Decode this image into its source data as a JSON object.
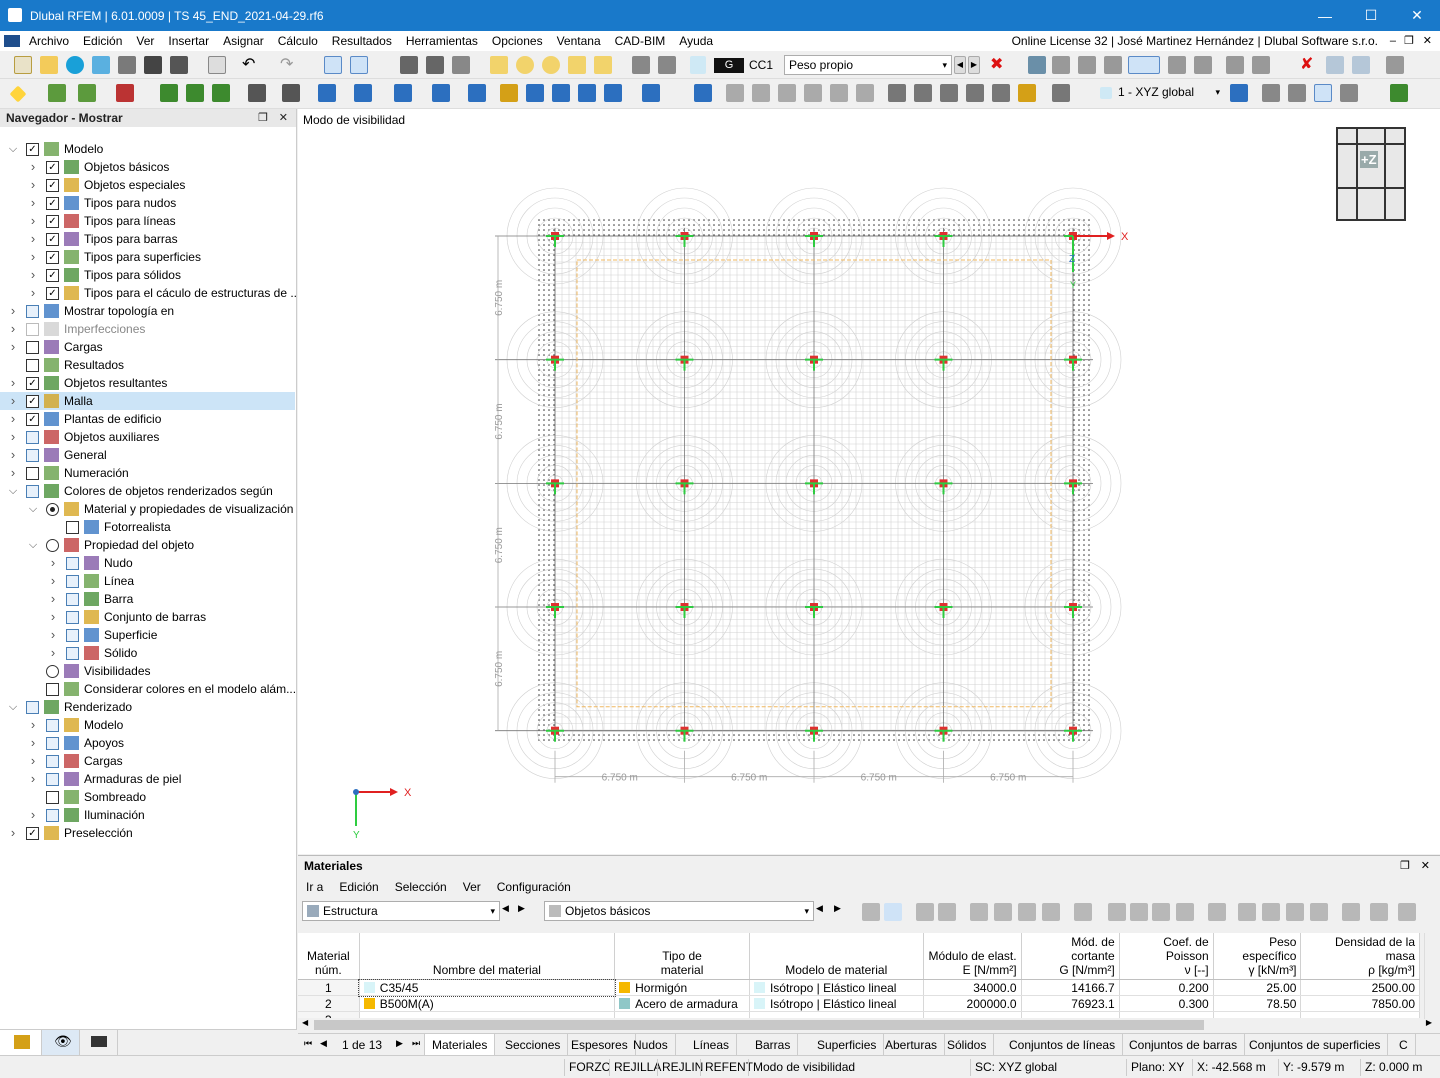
{
  "window": {
    "title": "Dlubal RFEM | 6.01.0009 | TS 45_END_2021-04-29.rf6",
    "minimize": "—",
    "maximize": "☐",
    "close": "✕"
  },
  "menu": {
    "items": [
      "Archivo",
      "Edición",
      "Ver",
      "Insertar",
      "Asignar",
      "Cálculo",
      "Resultados",
      "Herramientas",
      "Opciones",
      "Ventana",
      "CAD-BIM",
      "Ayuda"
    ],
    "license": "Online License 32 | José Martinez Hernández | Dlubal Software s.r.o."
  },
  "toolbar": {
    "load_badge": "G",
    "load_case": "CC1",
    "load_case_name": "Peso propio",
    "coord_system": "1 - XYZ global"
  },
  "navigator": {
    "title": "Navegador - Mostrar",
    "items": [
      {
        "label": "Modelo",
        "level": 0,
        "check": "checked",
        "exp": "open"
      },
      {
        "label": "Objetos básicos",
        "level": 1,
        "check": "checked",
        "exp": "closed"
      },
      {
        "label": "Objetos especiales",
        "level": 1,
        "check": "checked",
        "exp": "closed"
      },
      {
        "label": "Tipos para nudos",
        "level": 1,
        "check": "checked",
        "exp": "closed"
      },
      {
        "label": "Tipos para líneas",
        "level": 1,
        "check": "checked",
        "exp": "closed"
      },
      {
        "label": "Tipos para barras",
        "level": 1,
        "check": "checked",
        "exp": "closed"
      },
      {
        "label": "Tipos para superficies",
        "level": 1,
        "check": "checked",
        "exp": "closed"
      },
      {
        "label": "Tipos para sólidos",
        "level": 1,
        "check": "checked",
        "exp": "closed"
      },
      {
        "label": "Tipos para el cáculo de estructuras de ...",
        "level": 1,
        "check": "checked",
        "exp": "closed"
      },
      {
        "label": "Mostrar topología en",
        "level": 0,
        "check": "partial",
        "exp": "closed"
      },
      {
        "label": "Imperfecciones",
        "level": 0,
        "check": "disabled",
        "exp": "closed"
      },
      {
        "label": "Cargas",
        "level": 0,
        "check": "unchecked",
        "exp": "closed"
      },
      {
        "label": "Resultados",
        "level": 0,
        "check": "unchecked",
        "exp": "none"
      },
      {
        "label": "Objetos resultantes",
        "level": 0,
        "check": "checked",
        "exp": "closed"
      },
      {
        "label": "Malla",
        "level": 0,
        "check": "checked",
        "exp": "closed",
        "selected": true
      },
      {
        "label": "Plantas de edificio",
        "level": 0,
        "check": "checked",
        "exp": "closed"
      },
      {
        "label": "Objetos auxiliares",
        "level": 0,
        "check": "partial",
        "exp": "closed"
      },
      {
        "label": "General",
        "level": 0,
        "check": "partial",
        "exp": "closed"
      },
      {
        "label": "Numeración",
        "level": 0,
        "check": "unchecked",
        "exp": "closed"
      },
      {
        "label": "Colores de objetos renderizados según",
        "level": 0,
        "check": "partial",
        "exp": "open"
      },
      {
        "label": "Material y propiedades de visualización",
        "level": 1,
        "check": "radio-on",
        "exp": "open"
      },
      {
        "label": "Fotorrealista",
        "level": 2,
        "check": "unchecked",
        "exp": "none"
      },
      {
        "label": "Propiedad del objeto",
        "level": 1,
        "check": "radio-off",
        "exp": "open"
      },
      {
        "label": "Nudo",
        "level": 2,
        "check": "partial",
        "exp": "closed"
      },
      {
        "label": "Línea",
        "level": 2,
        "check": "partial",
        "exp": "closed"
      },
      {
        "label": "Barra",
        "level": 2,
        "check": "partial",
        "exp": "closed"
      },
      {
        "label": "Conjunto de barras",
        "level": 2,
        "check": "partial",
        "exp": "closed"
      },
      {
        "label": "Superficie",
        "level": 2,
        "check": "partial",
        "exp": "closed"
      },
      {
        "label": "Sólido",
        "level": 2,
        "check": "partial",
        "exp": "closed"
      },
      {
        "label": "Visibilidades",
        "level": 1,
        "check": "radio-off",
        "exp": "none"
      },
      {
        "label": "Considerar colores en el modelo alám...",
        "level": 1,
        "check": "unchecked",
        "exp": "none"
      },
      {
        "label": "Renderizado",
        "level": 0,
        "check": "partial",
        "exp": "open"
      },
      {
        "label": "Modelo",
        "level": 1,
        "check": "partial",
        "exp": "closed"
      },
      {
        "label": "Apoyos",
        "level": 1,
        "check": "partial",
        "exp": "closed"
      },
      {
        "label": "Cargas",
        "level": 1,
        "check": "partial",
        "exp": "closed"
      },
      {
        "label": "Armaduras de piel",
        "level": 1,
        "check": "partial",
        "exp": "closed"
      },
      {
        "label": "Sombreado",
        "level": 1,
        "check": "unchecked",
        "exp": "none"
      },
      {
        "label": "Iluminación",
        "level": 1,
        "check": "partial",
        "exp": "closed"
      },
      {
        "label": "Preselección",
        "level": 0,
        "check": "checked",
        "exp": "closed"
      }
    ]
  },
  "view": {
    "mode_label": "Modo de visibilidad",
    "cube_label": "+Z",
    "axis_x": "X",
    "axis_y": "Y",
    "axis_z": "Z",
    "dim_label": "6.750 m"
  },
  "materials": {
    "title": "Materiales",
    "menu": [
      "Ir a",
      "Edición",
      "Selección",
      "Ver",
      "Configuración"
    ],
    "filter1": "Estructura",
    "filter2": "Objetos básicos",
    "headers": [
      [
        "Material",
        "núm."
      ],
      [
        "",
        "Nombre del material"
      ],
      [
        "Tipo de",
        "material"
      ],
      [
        "",
        "Modelo de material"
      ],
      [
        "Módulo de elast.",
        "E [N/mm²]"
      ],
      [
        "Mód. de cortante",
        "G [N/mm²]"
      ],
      [
        "Coef. de Poisson",
        "ν [--]"
      ],
      [
        "Peso específico",
        "γ [kN/m³]"
      ],
      [
        "Densidad de la masa",
        "ρ [kg/m³]"
      ]
    ],
    "rows": [
      {
        "no": "1",
        "name": "C35/45",
        "name_color": "#d8f4f8",
        "type": "Hormigón",
        "type_color": "#f5b800",
        "model": "Isótropo | Elástico lineal",
        "E": "34000.0",
        "G": "14166.7",
        "nu": "0.200",
        "gamma": "25.00",
        "rho": "2500.00"
      },
      {
        "no": "2",
        "name": "B500M(A)",
        "name_color": "#f5b800",
        "type": "Acero de armadura",
        "type_color": "#8fc7c7",
        "model": "Isótropo | Elástico lineal",
        "E": "200000.0",
        "G": "76923.1",
        "nu": "0.300",
        "gamma": "78.50",
        "rho": "7850.00"
      },
      {
        "no": "3",
        "name": "",
        "name_color": "",
        "type": "",
        "type_color": "",
        "model": "",
        "E": "",
        "G": "",
        "nu": "",
        "gamma": "",
        "rho": ""
      }
    ],
    "pager": "1 de 13",
    "tabs": [
      "Materiales",
      "Secciones",
      "Espesores",
      "Nudos",
      "Líneas",
      "Barras",
      "Superficies",
      "Aberturas",
      "Sólidos",
      "Conjuntos de líneas",
      "Conjuntos de barras",
      "Conjuntos de superficies",
      "C"
    ]
  },
  "status": {
    "cells": [
      "FORZC",
      "REJILLA",
      "REJLIN",
      "REFENT",
      "Modo de visibilidad"
    ],
    "cs": "SC: XYZ global",
    "plane": "Plano: XY",
    "x": "X: -42.568 m",
    "y": "Y: -9.579 m",
    "z": "Z: 0.000 m"
  }
}
